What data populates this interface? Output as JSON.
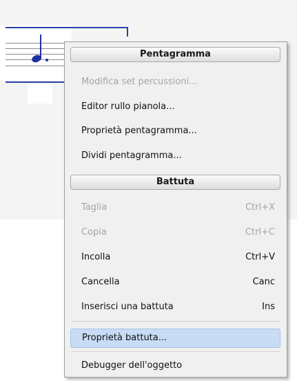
{
  "menu": {
    "sections": [
      {
        "header": "Pentagramma",
        "items": [
          {
            "label": "Modifica set percussioni...",
            "shortcut": "",
            "enabled": false
          },
          {
            "label": "Editor rullo pianola...",
            "shortcut": "",
            "enabled": true
          },
          {
            "label": "Proprietà pentagramma...",
            "shortcut": "",
            "enabled": true
          },
          {
            "label": "Dividi pentagramma...",
            "shortcut": "",
            "enabled": true
          }
        ]
      },
      {
        "header": "Battuta",
        "items": [
          {
            "label": "Taglia",
            "shortcut": "Ctrl+X",
            "enabled": false
          },
          {
            "label": "Copia",
            "shortcut": "Ctrl+C",
            "enabled": false
          },
          {
            "label": "Incolla",
            "shortcut": "Ctrl+V",
            "enabled": true
          },
          {
            "label": "Cancella",
            "shortcut": "Canc",
            "enabled": true
          },
          {
            "label": "Inserisci una battuta",
            "shortcut": "Ins",
            "enabled": true
          },
          {
            "label": "Proprietà battuta...",
            "shortcut": "",
            "enabled": true,
            "highlighted": true
          }
        ]
      }
    ],
    "footer_item": {
      "label": "Debugger dell'oggetto",
      "shortcut": "",
      "enabled": true
    }
  },
  "colors": {
    "menu_background": "#f0f0f0",
    "highlight": "#c8dcf6",
    "disabled_text": "#a4a4a4",
    "score_ink": "#2a3fa8"
  }
}
